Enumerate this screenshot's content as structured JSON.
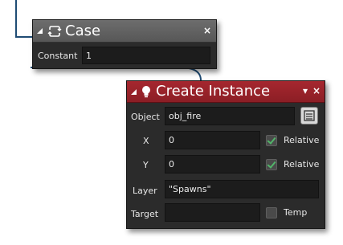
{
  "case_node": {
    "title": "Case",
    "close_icon": "×",
    "fields": {
      "constant_label": "Constant",
      "constant_value": "1"
    }
  },
  "create_instance_node": {
    "title": "Create Instance",
    "menu_icon": "▾",
    "close_icon": "×",
    "fields": {
      "object_label": "Object",
      "object_value": "obj_fire",
      "x_label": "X",
      "x_value": "0",
      "x_relative_label": "Relative",
      "x_relative_checked": true,
      "y_label": "Y",
      "y_value": "0",
      "y_relative_label": "Relative",
      "y_relative_checked": true,
      "layer_label": "Layer",
      "layer_value": "\"Spawns\"",
      "target_label": "Target",
      "target_value": "",
      "temp_label": "Temp",
      "temp_checked": false
    }
  },
  "colors": {
    "case_header": "#616161",
    "create_instance_header": "#9b222a",
    "connector": "#1f4c74",
    "check_accent": "#52b56a"
  }
}
